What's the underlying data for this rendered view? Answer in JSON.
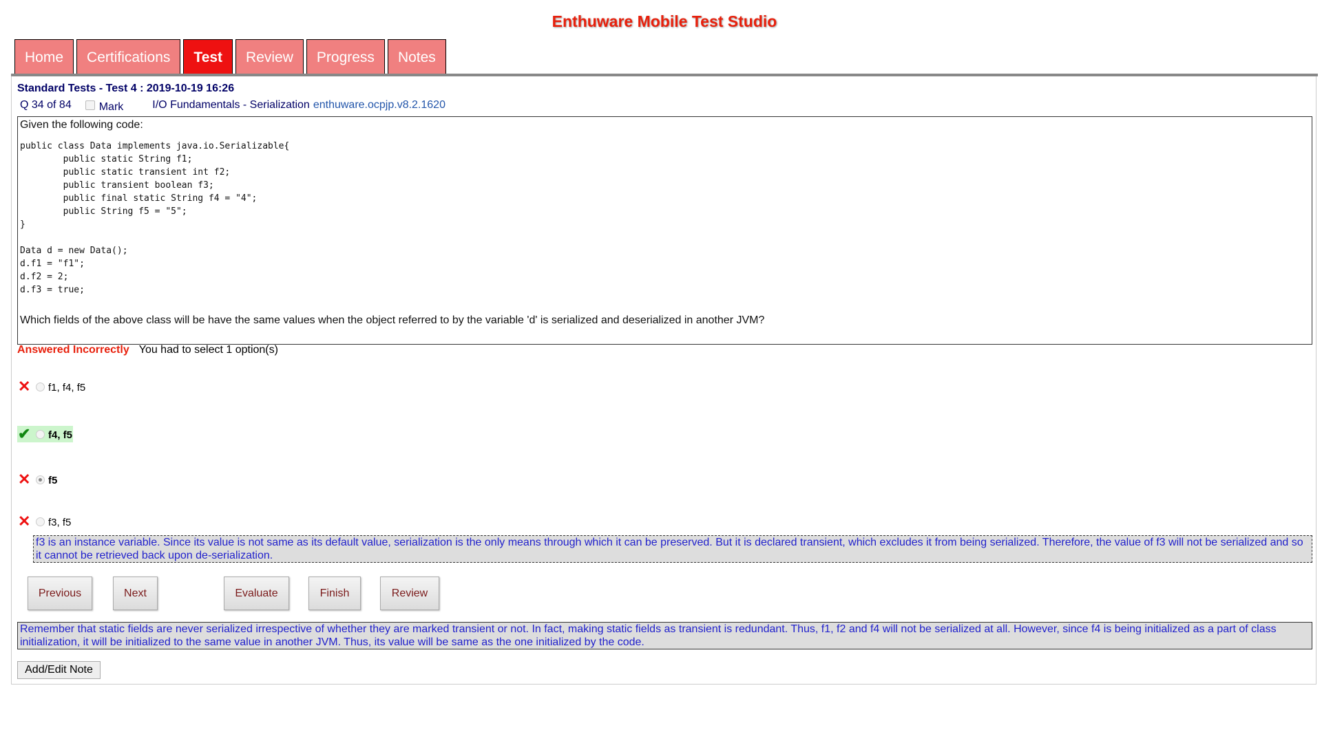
{
  "app_title": "Enthuware Mobile Test Studio",
  "tabs": [
    "Home",
    "Certifications",
    "Test",
    "Review",
    "Progress",
    "Notes"
  ],
  "header": {
    "title": "Standard Tests - Test 4 : 2019-10-19 16:26",
    "question_counter": "Q 34 of 84",
    "mark_label": "Mark",
    "topic": "I/O Fundamentals - Serialization",
    "question_id": "enthuware.ocpjp.v8.2.1620"
  },
  "question": {
    "intro": "Given the following code:",
    "code": "public class Data implements java.io.Serializable{\n        public static String f1;\n        public static transient int f2;\n        public transient boolean f3;\n        public final static String f4 = \"4\";\n        public String f5 = \"5\";\n}\n\nData d = new Data();\nd.f1 = \"f1\";\nd.f2 = 2;\nd.f3 = true;",
    "prompt": "Which fields of the above class will be have the same values when the object referred to by the variable 'd' is serialized and deserialized in another JVM?"
  },
  "result": {
    "status": "Answered Incorrectly",
    "instruction": "You had to select 1 option(s)"
  },
  "options": [
    {
      "label": "f1, f4, f5",
      "mark": "✕",
      "correct": false,
      "selected": false
    },
    {
      "label": "f4, f5",
      "mark": "✔",
      "correct": true,
      "selected": false
    },
    {
      "label": "f5",
      "mark": "✕",
      "correct": false,
      "selected": true
    },
    {
      "label": "f3, f5",
      "mark": "✕",
      "correct": false,
      "selected": false
    }
  ],
  "option_explanation": "f3 is an instance variable. Since its value is not same as its default value, serialization is the only means through which it can be preserved. But it is declared transient, which excludes it from being serialized. Therefore, the value of f3 will not be serialized and so it cannot be retrieved back upon de-serialization.",
  "buttons": {
    "previous": "Previous",
    "next": "Next",
    "evaluate": "Evaluate",
    "finish": "Finish",
    "review": "Review",
    "add_note": "Add/Edit Note"
  },
  "explanation": "Remember that static fields are never serialized irrespective of whether they are marked transient or not.  In fact, making static fields as transient is redundant. Thus, f1, f2 and f4 will not be serialized at all. However, since f4 is being initialized as a part of class initialization, it will be initialized to the same value in another JVM. Thus, its value will be same as the one initialized by the code."
}
